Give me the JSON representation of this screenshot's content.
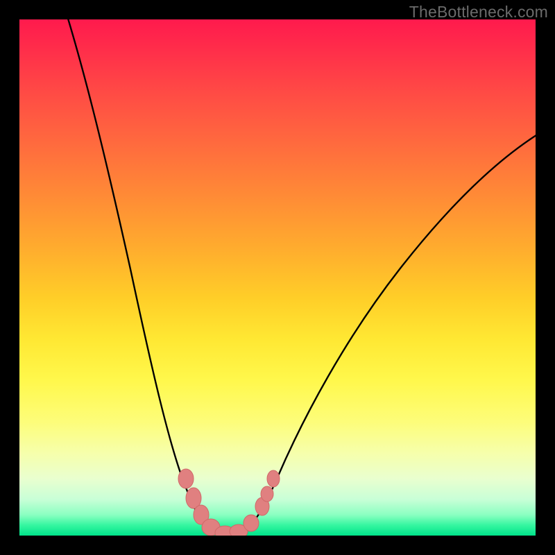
{
  "watermark": {
    "text": "TheBottleneck.com"
  },
  "colors": {
    "background": "#000000",
    "curve_stroke": "#000000",
    "marker_fill": "#e08080",
    "marker_stroke": "#d86f6f"
  },
  "chart_data": {
    "type": "line",
    "title": "",
    "xlabel": "",
    "ylabel": "",
    "xlim": [
      0,
      100
    ],
    "ylim": [
      0,
      100
    ],
    "note": "V-shaped bottleneck curve over rainbow gradient; minimum near x≈35 where bottleneck ≈0. Values are visual estimates from the image (no axes/ticks shown).",
    "series": [
      {
        "name": "bottleneck-curve",
        "x": [
          0,
          6,
          12,
          18,
          24,
          28,
          32,
          34,
          36,
          38,
          40,
          44,
          52,
          60,
          70,
          80,
          90,
          100
        ],
        "values": [
          150,
          96,
          72,
          50,
          30,
          16,
          4,
          0,
          0,
          0,
          3,
          10,
          24,
          37,
          49,
          58,
          64,
          68
        ]
      }
    ],
    "markers": {
      "name": "highlight-points",
      "x": [
        28.5,
        30.5,
        32.5,
        34.0,
        36.0,
        38.0,
        40.0,
        41.5,
        42.5,
        43.5
      ],
      "values": [
        14.0,
        8.0,
        3.0,
        0.5,
        0.3,
        0.3,
        2.5,
        6.5,
        9.5,
        12.5
      ]
    }
  }
}
